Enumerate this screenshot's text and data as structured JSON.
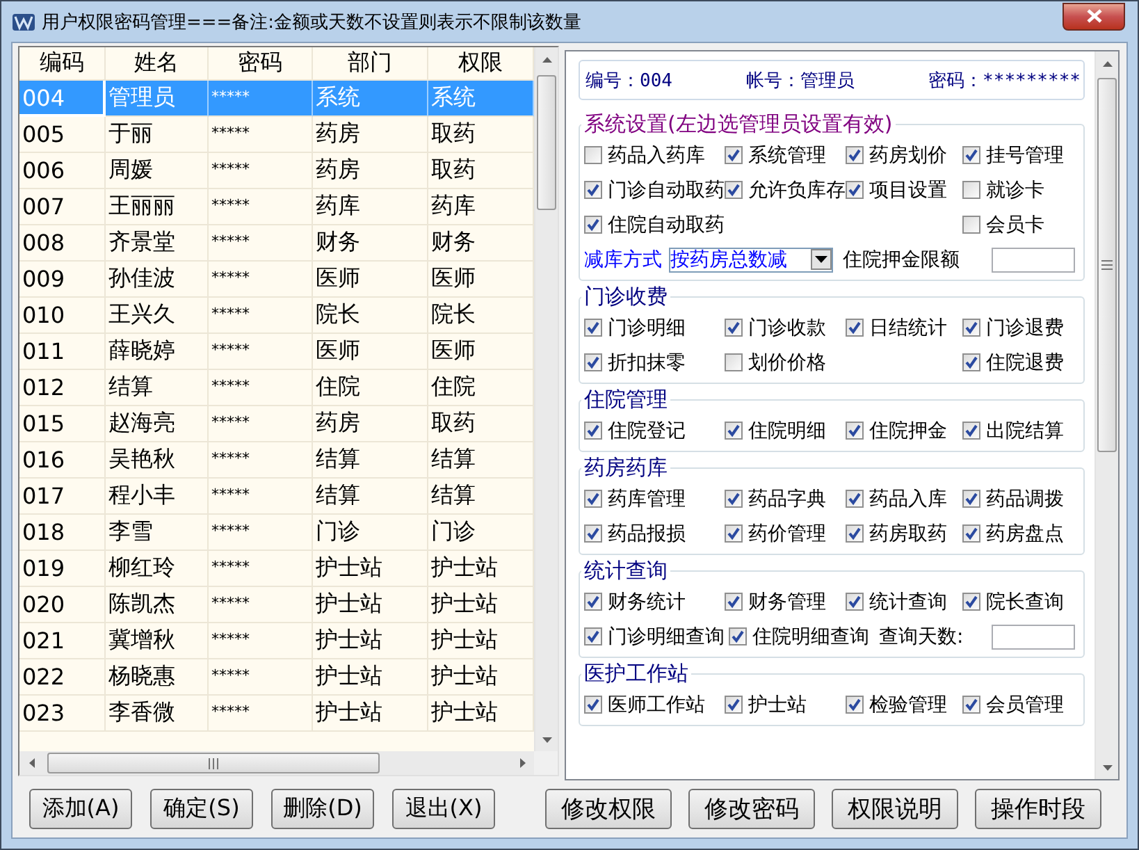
{
  "window": {
    "title": "用户权限密码管理===备注:金额或天数不设置则表示不限制该数量"
  },
  "users": {
    "columns": [
      "编码",
      "姓名",
      "密码",
      "部门",
      "权限"
    ],
    "rows": [
      {
        "cells": [
          "004",
          "管理员",
          "*****",
          "系统",
          "系统"
        ],
        "selected": true
      },
      {
        "cells": [
          "005",
          "于丽",
          "*****",
          "药房",
          "取药"
        ],
        "selected": false
      },
      {
        "cells": [
          "006",
          "周媛",
          "*****",
          "药房",
          "取药"
        ],
        "selected": false
      },
      {
        "cells": [
          "007",
          "王丽丽",
          "*****",
          "药库",
          "药库"
        ],
        "selected": false
      },
      {
        "cells": [
          "008",
          "齐景堂",
          "*****",
          "财务",
          "财务"
        ],
        "selected": false
      },
      {
        "cells": [
          "009",
          "孙佳波",
          "*****",
          "医师",
          "医师"
        ],
        "selected": false
      },
      {
        "cells": [
          "010",
          "王兴久",
          "*****",
          "院长",
          "院长"
        ],
        "selected": false
      },
      {
        "cells": [
          "011",
          "薛晓婷",
          "*****",
          "医师",
          "医师"
        ],
        "selected": false
      },
      {
        "cells": [
          "012",
          "结算",
          "*****",
          "住院",
          "住院"
        ],
        "selected": false
      },
      {
        "cells": [
          "015",
          "赵海亮",
          "*****",
          "药房",
          "取药"
        ],
        "selected": false
      },
      {
        "cells": [
          "016",
          "吴艳秋",
          "*****",
          "结算",
          "结算"
        ],
        "selected": false
      },
      {
        "cells": [
          "017",
          "程小丰",
          "*****",
          "结算",
          "结算"
        ],
        "selected": false
      },
      {
        "cells": [
          "018",
          "李雪",
          "*****",
          "门诊",
          "门诊"
        ],
        "selected": false
      },
      {
        "cells": [
          "019",
          "柳红玲",
          "*****",
          "护士站",
          "护士站"
        ],
        "selected": false
      },
      {
        "cells": [
          "020",
          "陈凯杰",
          "*****",
          "护士站",
          "护士站"
        ],
        "selected": false
      },
      {
        "cells": [
          "021",
          "冀增秋",
          "*****",
          "护士站",
          "护士站"
        ],
        "selected": false
      },
      {
        "cells": [
          "022",
          "杨晓惠",
          "*****",
          "护士站",
          "护士站"
        ],
        "selected": false
      },
      {
        "cells": [
          "023",
          "李香微",
          "*****",
          "护士站",
          "护士站"
        ],
        "selected": false
      }
    ]
  },
  "info": [
    {
      "label": "编号：",
      "value": "004"
    },
    {
      "label": "帐号：",
      "value": "管理员"
    },
    {
      "label": "密码：",
      "value": "*********"
    }
  ],
  "groups": [
    {
      "title": "系统设置(左边选管理员设置有效)",
      "color": "#800080",
      "rows": [
        {
          "kind": "grid",
          "items": [
            {
              "kind": "checkbox",
              "label": "药品入药库",
              "checked": false
            },
            {
              "kind": "checkbox",
              "label": "系统管理",
              "checked": true
            },
            {
              "kind": "checkbox",
              "label": "药房划价",
              "checked": true
            },
            {
              "kind": "checkbox",
              "label": "挂号管理",
              "checked": true
            }
          ]
        },
        {
          "kind": "grid",
          "items": [
            {
              "kind": "checkbox",
              "label": "门诊自动取药",
              "checked": true
            },
            {
              "kind": "checkbox",
              "label": "允许负库存",
              "checked": true
            },
            {
              "kind": "checkbox",
              "label": "项目设置",
              "checked": true
            },
            {
              "kind": "checkbox",
              "label": "就诊卡",
              "checked": false
            }
          ]
        },
        {
          "kind": "grid",
          "items": [
            {
              "kind": "checkbox",
              "label": "住院自动取药",
              "checked": true
            },
            {
              "kind": "checkbox",
              "label": "会员卡",
              "checked": false
            }
          ]
        },
        {
          "kind": "flow",
          "items": [
            {
              "kind": "select",
              "label": "减库方式",
              "value": "按药房总数减"
            },
            {
              "kind": "field",
              "label": "住院押金限额"
            }
          ]
        }
      ]
    },
    {
      "title": "门诊收费",
      "color": "#000080",
      "rows": [
        {
          "kind": "grid",
          "items": [
            {
              "kind": "checkbox",
              "label": "门诊明细",
              "checked": true
            },
            {
              "kind": "checkbox",
              "label": "门诊收款",
              "checked": true
            },
            {
              "kind": "checkbox",
              "label": "日结统计",
              "checked": true
            },
            {
              "kind": "checkbox",
              "label": "门诊退费",
              "checked": true
            }
          ]
        },
        {
          "kind": "grid",
          "items": [
            {
              "kind": "checkbox",
              "label": "折扣抹零",
              "checked": true
            },
            {
              "kind": "checkbox",
              "label": "划价价格",
              "checked": false
            },
            {
              "kind": "checkbox",
              "label": "住院退费",
              "checked": true
            }
          ]
        }
      ]
    },
    {
      "title": "住院管理",
      "color": "#000080",
      "rows": [
        {
          "kind": "grid",
          "items": [
            {
              "kind": "checkbox",
              "label": "住院登记",
              "checked": true
            },
            {
              "kind": "checkbox",
              "label": "住院明细",
              "checked": true
            },
            {
              "kind": "checkbox",
              "label": "住院押金",
              "checked": true
            },
            {
              "kind": "checkbox",
              "label": "出院结算",
              "checked": true
            }
          ]
        }
      ]
    },
    {
      "title": "药房药库",
      "color": "#000080",
      "rows": [
        {
          "kind": "grid",
          "items": [
            {
              "kind": "checkbox",
              "label": "药库管理",
              "checked": true
            },
            {
              "kind": "checkbox",
              "label": "药品字典",
              "checked": true
            },
            {
              "kind": "checkbox",
              "label": "药品入库",
              "checked": true
            },
            {
              "kind": "checkbox",
              "label": "药品调拨",
              "checked": true
            }
          ]
        },
        {
          "kind": "grid",
          "items": [
            {
              "kind": "checkbox",
              "label": "药品报损",
              "checked": true
            },
            {
              "kind": "checkbox",
              "label": "药价管理",
              "checked": true
            },
            {
              "kind": "checkbox",
              "label": "药房取药",
              "checked": true
            },
            {
              "kind": "checkbox",
              "label": "药房盘点",
              "checked": true
            }
          ]
        }
      ]
    },
    {
      "title": "统计查询",
      "color": "#000080",
      "rows": [
        {
          "kind": "grid",
          "items": [
            {
              "kind": "checkbox",
              "label": "财务统计",
              "checked": true
            },
            {
              "kind": "checkbox",
              "label": "财务管理",
              "checked": true
            },
            {
              "kind": "checkbox",
              "label": "统计查询",
              "checked": true
            },
            {
              "kind": "checkbox",
              "label": "院长查询",
              "checked": true
            }
          ]
        },
        {
          "kind": "flow",
          "items": [
            {
              "kind": "checkbox",
              "label": "门诊明细查询",
              "checked": true
            },
            {
              "kind": "checkbox",
              "label": "住院明细查询",
              "checked": true
            },
            {
              "kind": "field",
              "label": "查询天数:"
            }
          ]
        }
      ]
    },
    {
      "title": "医护工作站",
      "color": "#000080",
      "rows": [
        {
          "kind": "grid",
          "items": [
            {
              "kind": "checkbox",
              "label": "医师工作站",
              "checked": true
            },
            {
              "kind": "checkbox",
              "label": "护士站",
              "checked": true
            },
            {
              "kind": "checkbox",
              "label": "检验管理",
              "checked": true
            },
            {
              "kind": "checkbox",
              "label": "会员管理",
              "checked": true
            }
          ]
        }
      ]
    }
  ],
  "left_buttons": [
    "添加(A)",
    "确定(S)",
    "删除(D)",
    "退出(X)"
  ],
  "right_buttons": [
    "修改权限",
    "修改密码",
    "权限说明",
    "操作时段"
  ]
}
